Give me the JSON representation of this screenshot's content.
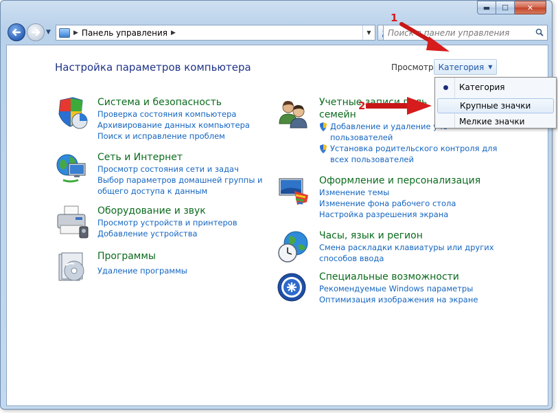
{
  "window": {
    "caption_buttons": {
      "minimize": "▬",
      "maximize": "☐",
      "close": "✕"
    }
  },
  "nav": {
    "address_text": "Панель управления",
    "search_placeholder": "Поиск в панели управления"
  },
  "page": {
    "title": "Настройка параметров компьютера",
    "view_label": "Просмотр:",
    "view_value": "Категория"
  },
  "view_menu": {
    "items": [
      "Категория",
      "Крупные значки",
      "Мелкие значки"
    ]
  },
  "categories_left": [
    {
      "title": "Система и безопасность",
      "icon": "shield-chart-icon",
      "links": [
        "Проверка состояния компьютера",
        "Архивирование данных компьютера",
        "Поиск и исправление проблем"
      ]
    },
    {
      "title": "Сеть и Интернет",
      "icon": "network-globe-icon",
      "links": [
        "Просмотр состояния сети и задач",
        "Выбор параметров домашней группы и",
        "общего доступа к данным"
      ]
    },
    {
      "title": "Оборудование и звук",
      "icon": "printer-icon",
      "links": [
        "Просмотр устройств и принтеров",
        "Добавление устройства"
      ]
    },
    {
      "title": "Программы",
      "icon": "programs-disk-icon",
      "links": [
        "Удаление программы"
      ]
    }
  ],
  "categories_right": [
    {
      "title_line1": "Учетные записи поль",
      "title_line2": "семейн",
      "icon": "users-icon",
      "links": [
        "Добавление и удаление уче",
        "пользователей",
        "Установка родительского контроля для",
        "всех пользователей"
      ]
    },
    {
      "title": "Оформление и персонализация",
      "icon": "monitor-palette-icon",
      "links": [
        "Изменение темы",
        "Изменение фона рабочего стола",
        "Настройка разрешения экрана"
      ]
    },
    {
      "title": "Часы, язык и регион",
      "icon": "clock-globe-icon",
      "links": [
        "Смена раскладки клавиатуры или других",
        "способов ввода"
      ]
    },
    {
      "title": "Специальные возможности",
      "icon": "accessibility-icon",
      "links": [
        "Рекомендуемые Windows параметры",
        "Оптимизация изображения на экране"
      ]
    }
  ],
  "annotations": {
    "label1": "1",
    "label2": "2"
  },
  "colors": {
    "link": "#1465c0",
    "category_title": "#0b6b1d",
    "arrow": "#d61c1c"
  }
}
